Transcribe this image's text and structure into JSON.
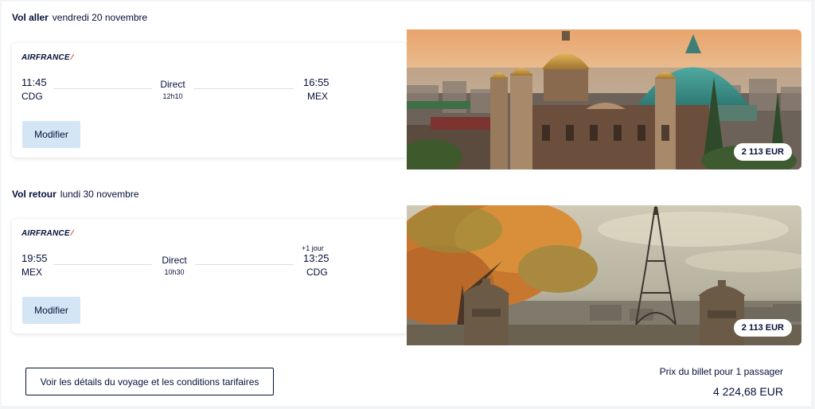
{
  "outbound": {
    "label": "Vol aller",
    "date": "vendredi 20 novembre",
    "airline": "AIRFRANCE",
    "depart_time": "11:45",
    "depart_code": "CDG",
    "arrive_time": "16:55",
    "arrive_code": "MEX",
    "stops": "Direct",
    "duration": "12h10",
    "modify_label": "Modifier",
    "price": "2 113 EUR",
    "photo_icon": "mexico-city-basilica-image"
  },
  "return": {
    "label": "Vol retour",
    "date": "lundi 30 novembre",
    "airline": "AIRFRANCE",
    "depart_time": "19:55",
    "depart_code": "MEX",
    "arrive_time": "13:25",
    "arrive_code": "CDG",
    "arrive_day_offset": "+1 jour",
    "stops": "Direct",
    "duration": "10h30",
    "modify_label": "Modifier",
    "price": "2 113 EUR",
    "photo_icon": "paris-eiffel-tower-image"
  },
  "footer": {
    "details_button": "Voir les détails du voyage et les conditions tarifaires",
    "total_label": "Prix du billet pour 1 passager",
    "total_value": "4 224,68 EUR"
  },
  "colors": {
    "brand_navy": "#051039",
    "airfrance_red": "#e1251b",
    "modify_button_bg": "#d4e6f5"
  }
}
